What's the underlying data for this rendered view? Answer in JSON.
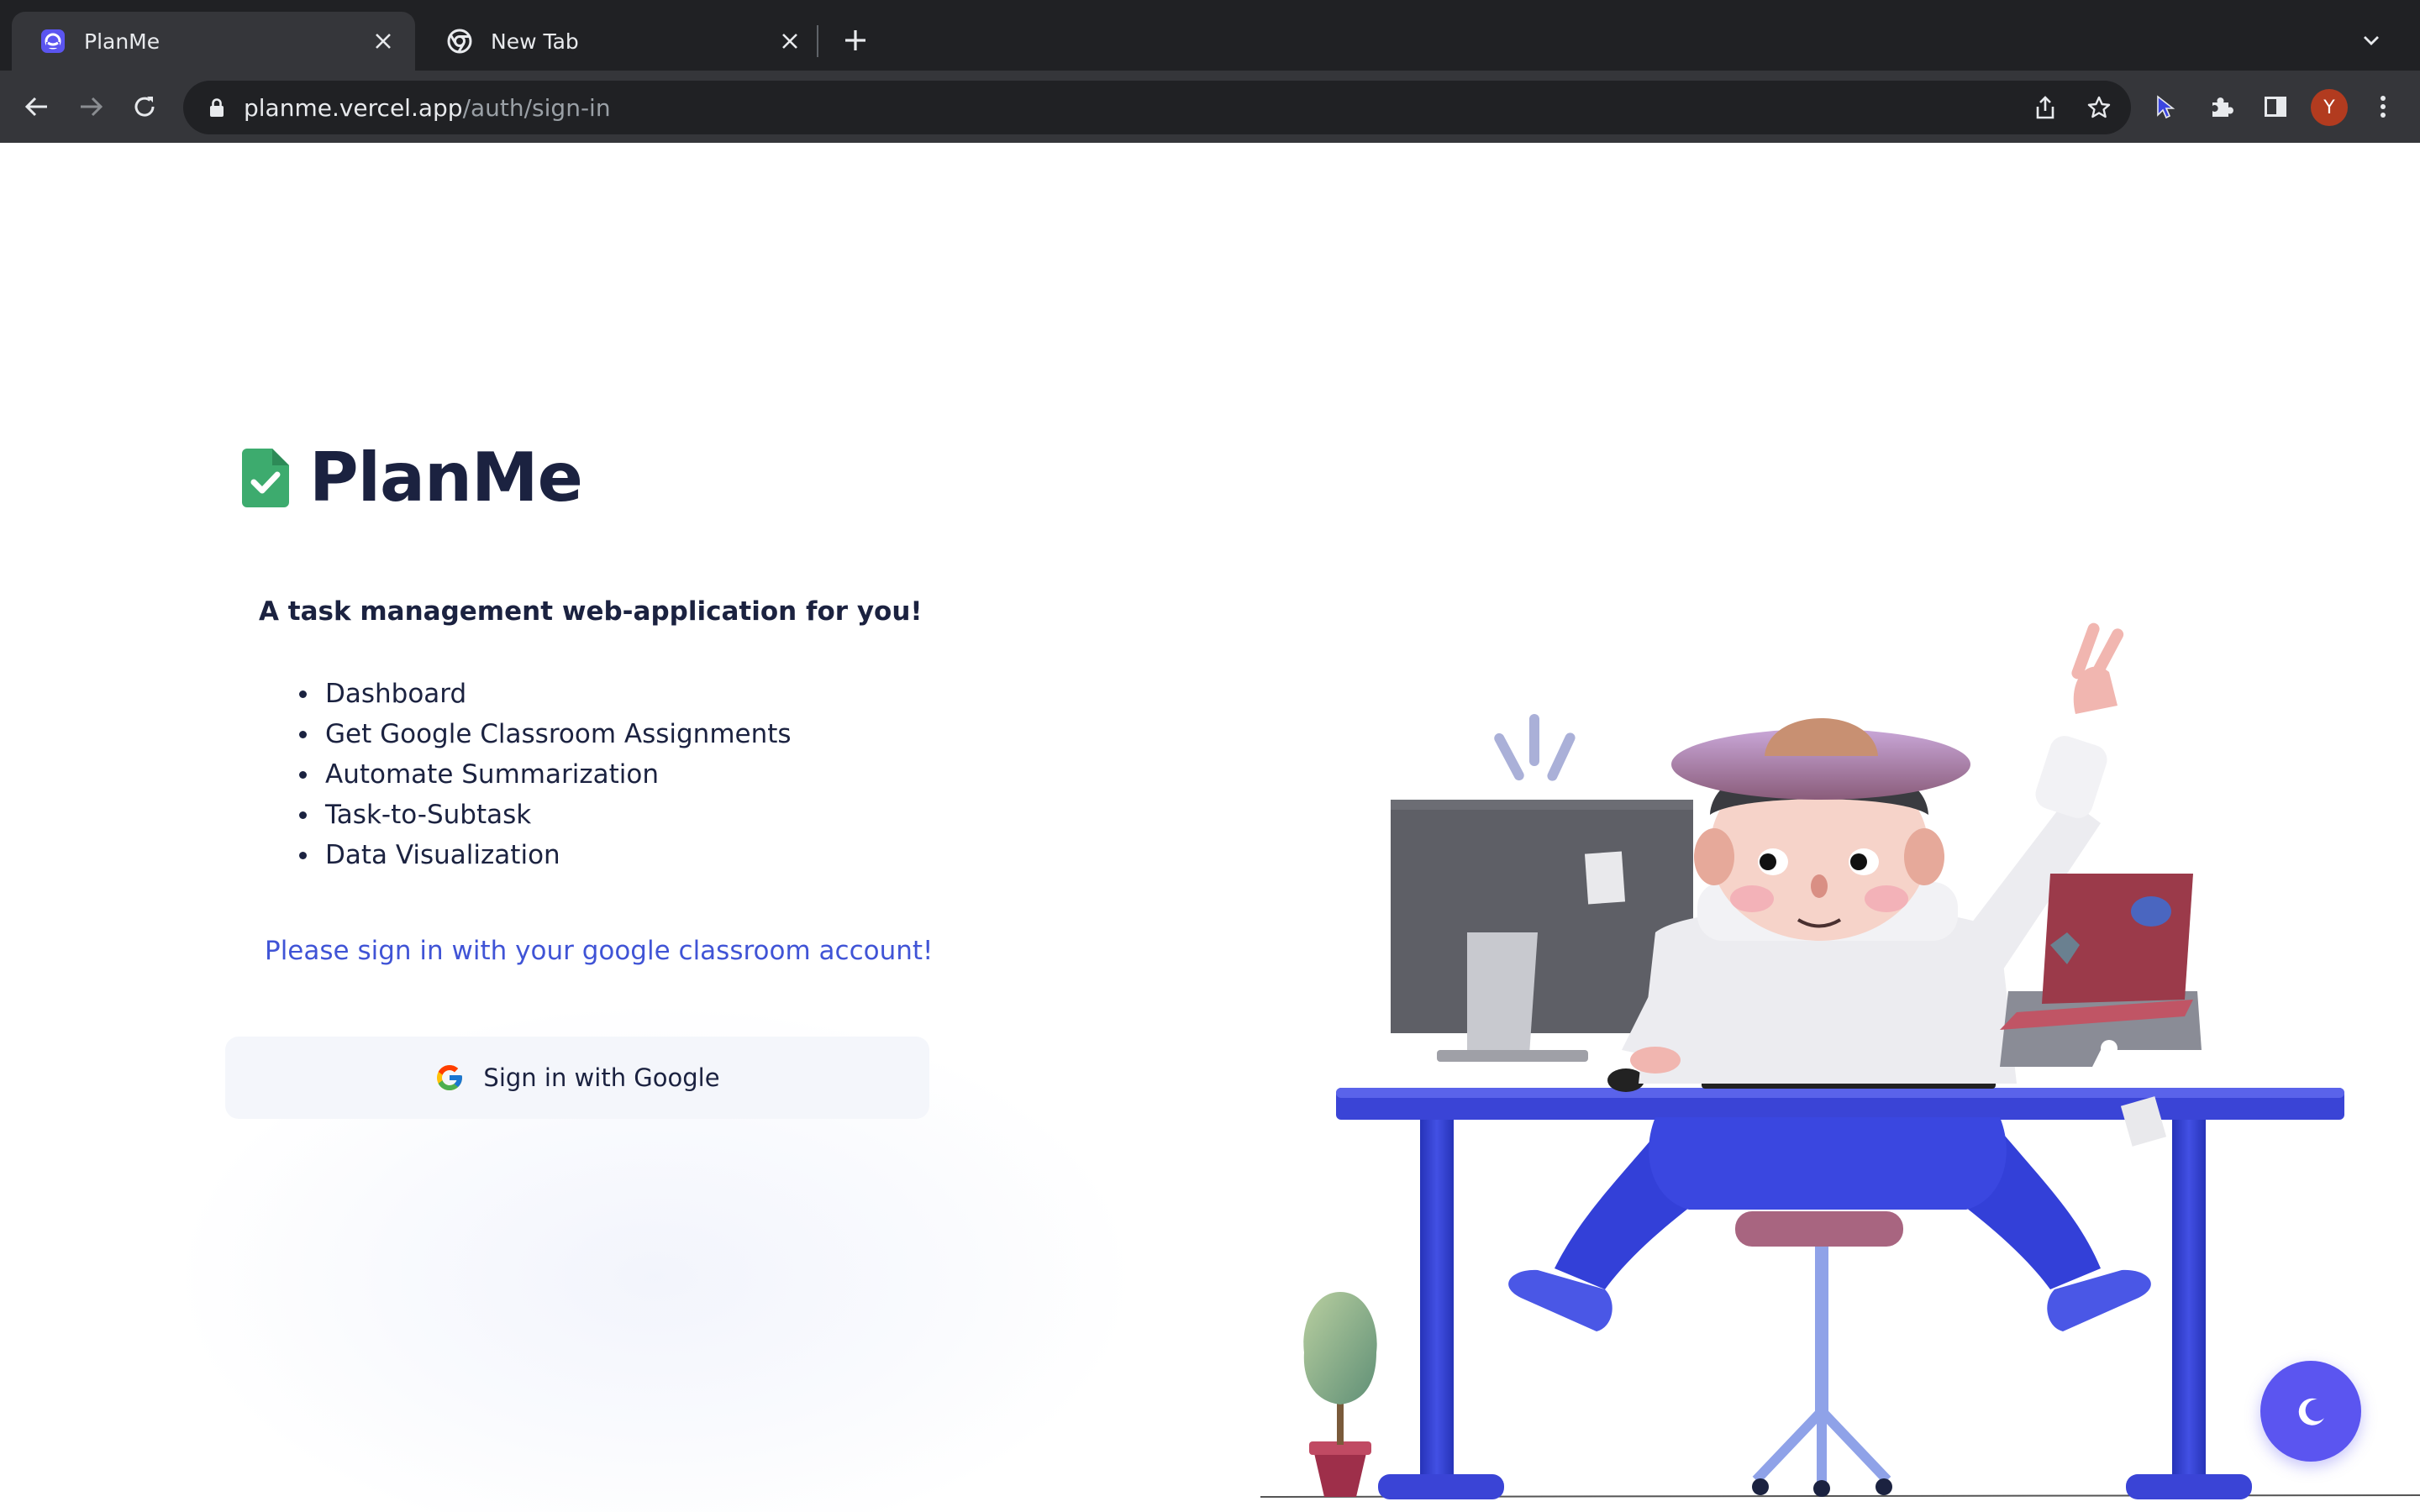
{
  "browser": {
    "tabs": [
      {
        "title": "PlanMe",
        "active": true,
        "favicon": "planme-favicon"
      },
      {
        "title": "New Tab",
        "active": false,
        "favicon": "chrome-icon"
      }
    ],
    "address": {
      "domain": "planme.vercel.app",
      "path": "/auth/sign-in"
    },
    "profile_initial": "Y",
    "colors": {
      "frame": "#202124",
      "toolbar": "#35363a",
      "avatar": "#b23b1f"
    }
  },
  "page": {
    "brand_name": "PlanMe",
    "tagline": "A task management web-application for you!",
    "features": [
      "Dashboard",
      "Get Google Classroom Assignments",
      "Automate Summarization",
      "Task-to-Subtask",
      "Data Visualization"
    ],
    "sign_in_prompt": "Please sign in with your google classroom account!",
    "google_button_label": "Sign in with Google",
    "illustration": "person-at-desk-illustration",
    "theme_toggle_icon": "moon-icon",
    "colors": {
      "heading": "#1b2240",
      "prompt": "#4054d6",
      "logo": "#3dab6e",
      "toggle": "#5b55f0",
      "desk": "#3a44d6"
    }
  }
}
